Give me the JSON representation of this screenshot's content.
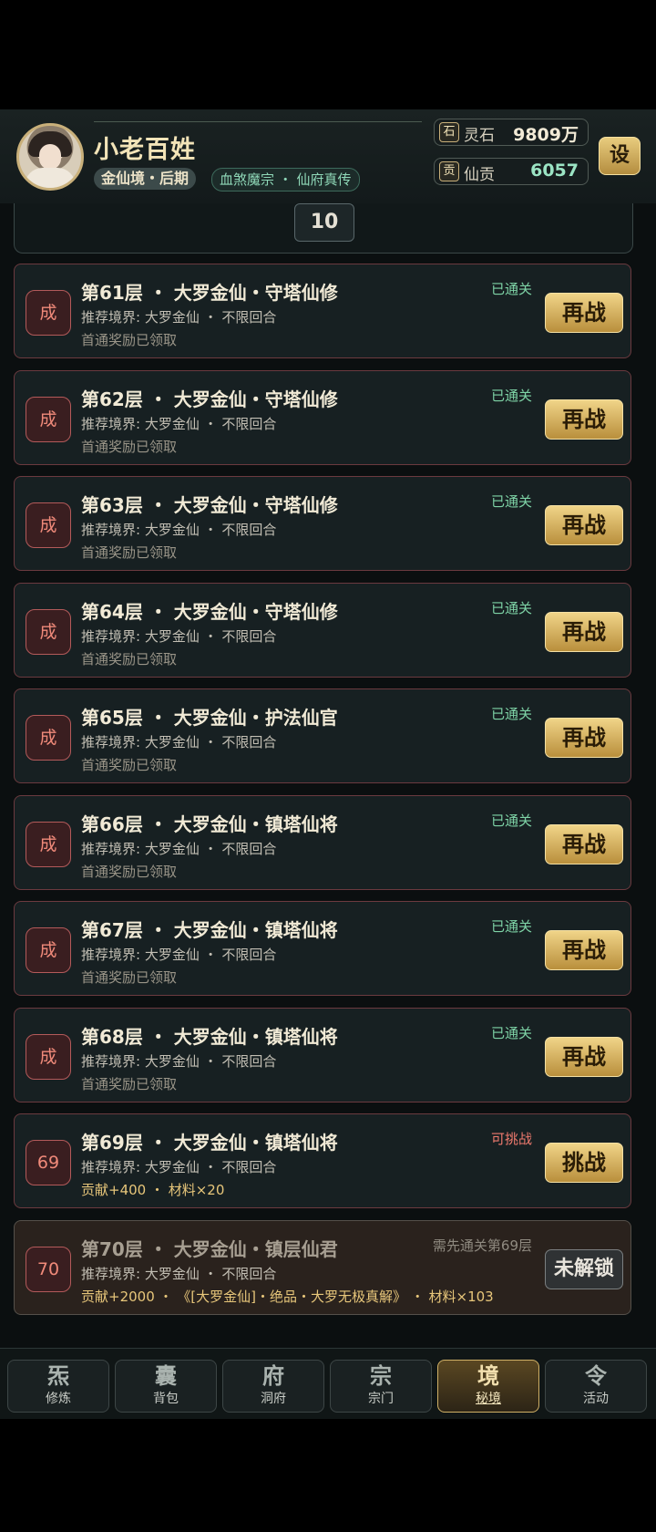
{
  "player": {
    "name": "小老百姓",
    "realm": "金仙境・后期",
    "sect": "血煞魔宗 ・ 仙府真传"
  },
  "resources": [
    {
      "icon_char": "石",
      "label": "灵石",
      "value": "9809万",
      "color": "#f2ead6"
    },
    {
      "icon_char": "贡",
      "label": "仙贡",
      "value": "6057",
      "color": "#9be4c4"
    }
  ],
  "settings_label": "设",
  "pagination": {
    "current": "10"
  },
  "floors": [
    {
      "title": "第61层 ・ 大罗金仙・守塔仙修",
      "sub": "推荐境界: 大罗金仙 ・ 不限回合",
      "note": "首通奖励已领取",
      "badge": "成",
      "status": "已通关",
      "button": "再战",
      "state": "done"
    },
    {
      "title": "第62层 ・ 大罗金仙・守塔仙修",
      "sub": "推荐境界: 大罗金仙 ・ 不限回合",
      "note": "首通奖励已领取",
      "badge": "成",
      "status": "已通关",
      "button": "再战",
      "state": "done"
    },
    {
      "title": "第63层 ・ 大罗金仙・守塔仙修",
      "sub": "推荐境界: 大罗金仙 ・ 不限回合",
      "note": "首通奖励已领取",
      "badge": "成",
      "status": "已通关",
      "button": "再战",
      "state": "done"
    },
    {
      "title": "第64层 ・ 大罗金仙・守塔仙修",
      "sub": "推荐境界: 大罗金仙 ・ 不限回合",
      "note": "首通奖励已领取",
      "badge": "成",
      "status": "已通关",
      "button": "再战",
      "state": "done"
    },
    {
      "title": "第65层 ・ 大罗金仙・护法仙官",
      "sub": "推荐境界: 大罗金仙 ・ 不限回合",
      "note": "首通奖励已领取",
      "badge": "成",
      "status": "已通关",
      "button": "再战",
      "state": "done"
    },
    {
      "title": "第66层 ・ 大罗金仙・镇塔仙将",
      "sub": "推荐境界: 大罗金仙 ・ 不限回合",
      "note": "首通奖励已领取",
      "badge": "成",
      "status": "已通关",
      "button": "再战",
      "state": "done"
    },
    {
      "title": "第67层 ・ 大罗金仙・镇塔仙将",
      "sub": "推荐境界: 大罗金仙 ・ 不限回合",
      "note": "首通奖励已领取",
      "badge": "成",
      "status": "已通关",
      "button": "再战",
      "state": "done"
    },
    {
      "title": "第68层 ・ 大罗金仙・镇塔仙将",
      "sub": "推荐境界: 大罗金仙 ・ 不限回合",
      "note": "首通奖励已领取",
      "badge": "成",
      "status": "已通关",
      "button": "再战",
      "state": "done"
    },
    {
      "title": "第69层 ・ 大罗金仙・镇塔仙将",
      "sub": "推荐境界: 大罗金仙 ・ 不限回合",
      "note": "贡献+400 ・ 材料×20",
      "badge": "69",
      "status": "可挑战",
      "button": "挑战",
      "state": "avail"
    },
    {
      "title": "第70层 ・ 大罗金仙・镇层仙君",
      "sub": "推荐境界: 大罗金仙 ・ 不限回合",
      "note": "贡献+2000 ・ 《[大罗金仙]・绝品・大罗无极真解》 ・ 材料×103",
      "badge": "70",
      "status": "需先通关第69层",
      "button": "未解锁",
      "state": "lock"
    }
  ],
  "nav": [
    {
      "icon_char": "炁",
      "label": "修炼",
      "active": false
    },
    {
      "icon_char": "囊",
      "label": "背包",
      "active": false
    },
    {
      "icon_char": "府",
      "label": "洞府",
      "active": false
    },
    {
      "icon_char": "宗",
      "label": "宗门",
      "active": false
    },
    {
      "icon_char": "境",
      "label": "秘境",
      "active": true
    },
    {
      "icon_char": "令",
      "label": "活动",
      "active": false
    }
  ]
}
